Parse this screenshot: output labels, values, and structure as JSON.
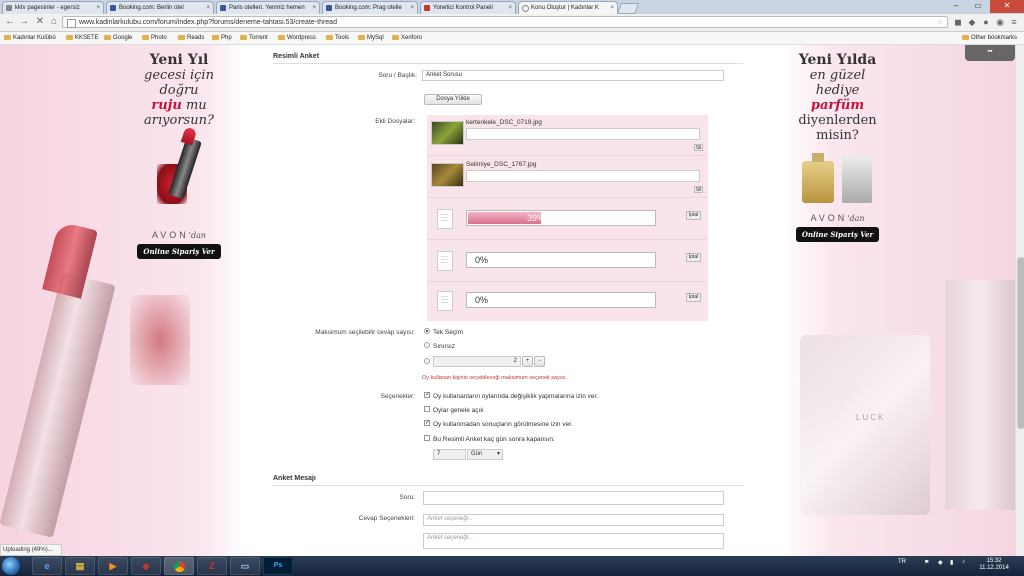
{
  "browser": {
    "tabs": [
      {
        "title": "kktv pagesinler - egersiz"
      },
      {
        "title": "Booking.com: Berlin otel"
      },
      {
        "title": "Paris otelleri. Yenmiz hemen"
      },
      {
        "title": "Booking.com: Prag otelle"
      },
      {
        "title": "Yonetici Kontrol Paneli"
      },
      {
        "title": "Konu Oluştur | Kadınlar K"
      }
    ],
    "url": "www.kadinlarkulubu.com/forum/index.php?forums/deneme-tahtasi.53/create-thread",
    "bookmarks": [
      "Kadınlar Kulübü",
      "KKSETE",
      "Google",
      "Photo",
      "Reads",
      "Php",
      "Torrent",
      "Wordpress",
      "Tools",
      "MySql",
      "Xenforo"
    ],
    "other_bookmarks": "Other bookmarks",
    "status": "Uploading (49%)..."
  },
  "ad_left": {
    "line1": "Yeni Yıl",
    "line2": "gecesi için",
    "line3": "doğru",
    "line4": "ruju",
    "line4b": "mu",
    "line5": "arıyorsun?",
    "brand": "AVON",
    "brand_suffix": "'dan",
    "cta": "Online Sipariş Ver"
  },
  "ad_right": {
    "line1": "Yeni Yılda",
    "line2": "en güzel",
    "line3": "hediye",
    "line4": "parfüm",
    "line5": "diyenlerden",
    "line6": "misin?",
    "brand": "AVON",
    "brand_suffix": "'dan",
    "cta": "Online Sipariş Ver"
  },
  "form": {
    "section_title": "Resimli Anket",
    "question_label": "Soru / Başlık:",
    "question_value": "Anket Sorusu",
    "upload_button": "Dosya Yükle",
    "attachments_label": "Ekli Dosyalar:",
    "attachments": [
      {
        "name": "kertenkele_DSC_0719.jpg",
        "delete": "Sil"
      },
      {
        "name": "Selimiye_DSC_1767.jpg",
        "delete": "Sil"
      }
    ],
    "uploads": [
      {
        "percent": "39%",
        "progress": 0.39,
        "cancel": "İptal"
      },
      {
        "percent": "0%",
        "progress": 0,
        "cancel": "İptal"
      },
      {
        "percent": "0%",
        "progress": 0,
        "cancel": "İptal"
      }
    ],
    "max_label": "Maksimum seçilebilir cevap sayısı:",
    "max_options": [
      "Tek Seçim",
      "Sınırsız"
    ],
    "max_number": "2",
    "max_hint": "Oy kullanan kişinin seçebileceği maksimum seçenek sayısı.",
    "options_label": "Seçenekler:",
    "options": [
      {
        "text": "Oy kullananların oylarında değişiklik yapmalarına izin ver.",
        "checked": true
      },
      {
        "text": "Oylar genele açık",
        "checked": false
      },
      {
        "text": "Oy kullanmadan sonuçların görülmesine izin ver.",
        "checked": true
      },
      {
        "text": "Bu Resimli Anket kaç gün sonra kapansın:",
        "checked": false
      }
    ],
    "close_days": "7",
    "close_unit": "Gün",
    "poll_message_title": "Anket Mesajı",
    "poll_question_label": "Soru:",
    "poll_answers_label": "Cevap Seçenekleri:",
    "answer_placeholder": "Anket seçeneği..."
  },
  "taskbar": {
    "lang": "TR",
    "time": "15:32",
    "date": "11.12.2014"
  }
}
